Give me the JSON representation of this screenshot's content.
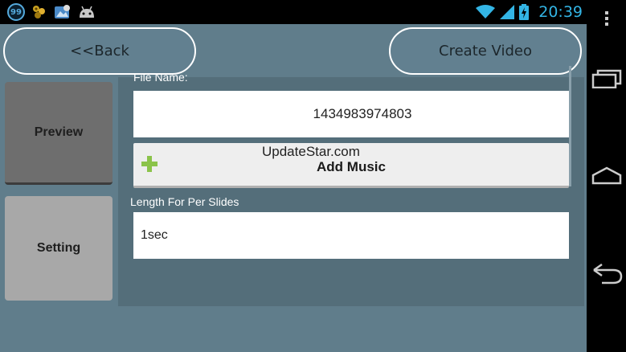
{
  "status_bar": {
    "notification_badge": "99",
    "time": "20:39",
    "left_icons": [
      "badge-99-icon",
      "puzzle-icon",
      "image-sync-icon",
      "android-icon"
    ],
    "right_icons": [
      "wifi-icon",
      "signal-icon",
      "battery-icon"
    ]
  },
  "header": {
    "back_label": "<<Back",
    "create_label": "Create Video"
  },
  "sidebar": {
    "preview_label": "Preview",
    "setting_label": "Setting"
  },
  "form": {
    "file_name_label": "File Name:",
    "file_name_value": "1434983974803",
    "add_music_label": "Add Music",
    "watermark": "UpdateStar.com",
    "length_label": "Length For Per Slides",
    "length_value": "1sec"
  },
  "nav_bar": {
    "icons": [
      "overflow-menu-icon",
      "recent-apps-icon",
      "home-icon",
      "back-icon"
    ]
  },
  "colors": {
    "background": "#607d8b",
    "panel": "#546e7a",
    "accent_clock": "#33b5e5",
    "plus_green": "#8bc34a"
  }
}
